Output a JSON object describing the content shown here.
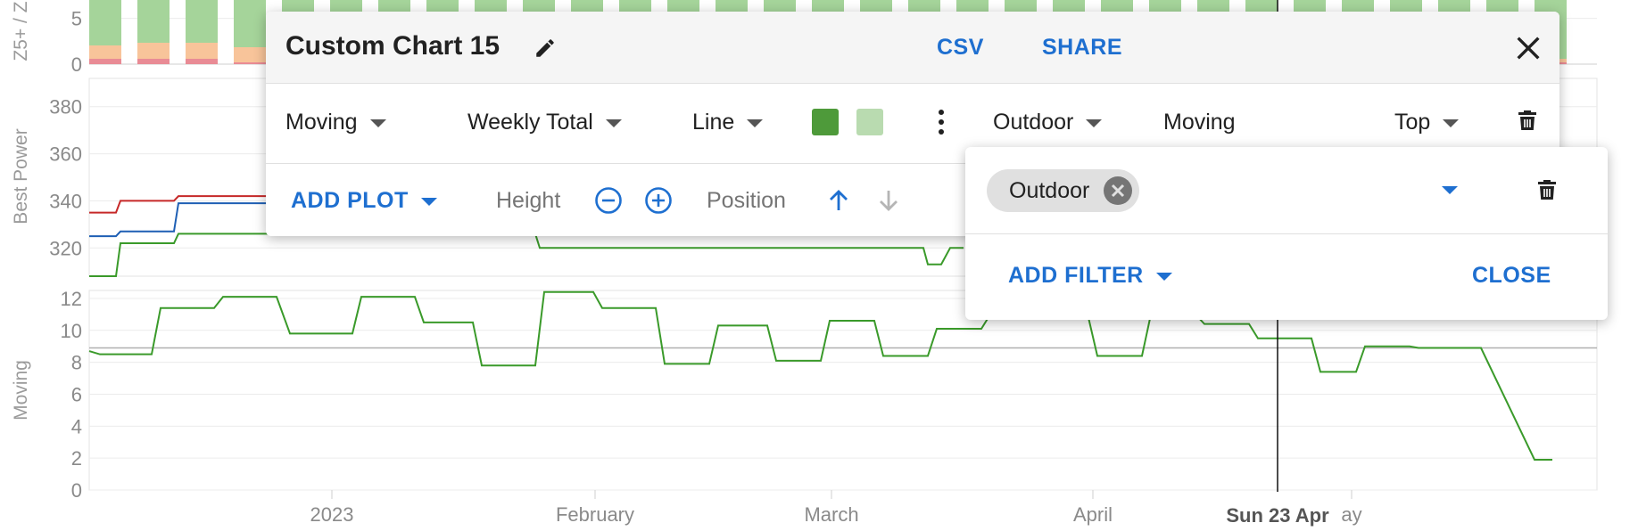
{
  "dialog": {
    "title": "Custom Chart 15",
    "csv_label": "CSV",
    "share_label": "SHARE",
    "plot_row": {
      "field": "Moving",
      "aggregation": "Weekly Total",
      "chart_type": "Line",
      "color_primary": "#4e9a3a",
      "color_secondary": "#b9dbb0",
      "filter_field": "Outdoor",
      "filter_value": "Moving",
      "position": "Top"
    },
    "actions": {
      "add_plot_label": "ADD PLOT",
      "height_label": "Height",
      "position_label": "Position"
    }
  },
  "filter_popup": {
    "chip_label": "Outdoor",
    "add_filter_label": "ADD FILTER",
    "close_label": "CLOSE"
  },
  "chart_data": [
    {
      "type": "bar",
      "ylabel": "Z5+ / Z",
      "ytick_labels": [
        "0",
        "5"
      ],
      "ylim": [
        0,
        7
      ],
      "grid": true,
      "series_colors": [
        "#a5d49a",
        "#f8c49a",
        "#e98b95"
      ]
    },
    {
      "type": "line",
      "ylabel": "Best Power",
      "ytick_labels": [
        "320",
        "340",
        "360",
        "380"
      ],
      "yticks": [
        320,
        340,
        360,
        380
      ],
      "ylim": [
        308,
        392
      ],
      "grid": true,
      "series": [
        {
          "color": "#c62828",
          "x": [
            0,
            30,
            35,
            95,
            100,
            290
          ],
          "y": [
            335,
            335,
            340,
            340,
            342,
            342
          ]
        },
        {
          "color": "#1e5fb4",
          "x": [
            0,
            30,
            35,
            95,
            100,
            290
          ],
          "y": [
            325,
            325,
            327,
            327,
            339,
            339
          ]
        },
        {
          "color": "#3a9a2a",
          "x": [
            0,
            30,
            35,
            95,
            100,
            500,
            505,
            935,
            940,
            955,
            965,
            980
          ],
          "y": [
            308,
            308,
            322,
            322,
            326,
            326,
            320,
            320,
            313,
            313,
            320,
            320
          ]
        }
      ]
    },
    {
      "type": "line",
      "ylabel": "Moving",
      "yticks": [
        0,
        2,
        4,
        6,
        8,
        10,
        12
      ],
      "ytick_labels": [
        "0",
        "2",
        "4",
        "6",
        "8",
        "10",
        "12"
      ],
      "ylim": [
        0,
        12.5
      ],
      "grid": true,
      "reference_line": 8.9,
      "series": [
        {
          "color": "#3a9a2a",
          "x": [
            0,
            12,
            70,
            80,
            140,
            150,
            210,
            225,
            295,
            305,
            365,
            375,
            430,
            440,
            500,
            510,
            565,
            575,
            635,
            645,
            695,
            705,
            760,
            770,
            820,
            830,
            880,
            890,
            940,
            950,
            1000,
            1010,
            1060,
            1070,
            1120,
            1130,
            1180,
            1190,
            1240,
            1250,
            1300,
            1310,
            1370,
            1380,
            1420,
            1430,
            1480,
            1490,
            1550,
            1560,
            1620,
            1640
          ],
          "y": [
            8.7,
            8.5,
            8.5,
            11.4,
            11.4,
            12.1,
            12.1,
            9.8,
            9.8,
            12.1,
            12.1,
            10.5,
            10.5,
            7.8,
            7.8,
            12.4,
            12.4,
            11.4,
            11.4,
            7.9,
            7.9,
            10.3,
            10.3,
            8.1,
            8.1,
            10.6,
            10.6,
            8.4,
            8.4,
            10.1,
            10.1,
            11,
            11,
            10.8,
            10.8,
            8.4,
            8.4,
            11,
            11,
            10.4,
            10.4,
            9.5,
            9.5,
            7.4,
            7.4,
            9,
            9,
            8.9,
            8.9,
            8.9,
            1.9,
            1.9
          ]
        }
      ]
    }
  ],
  "x_axis": {
    "tick_labels": [
      "2023",
      "February",
      "March",
      "April",
      "ay"
    ],
    "hover_label": "Sun 23 Apr"
  }
}
